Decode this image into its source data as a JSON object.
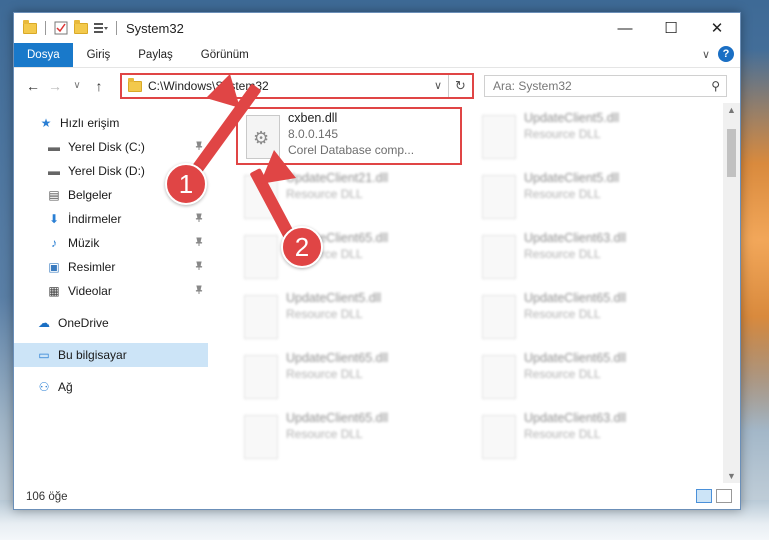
{
  "window": {
    "title": "System32",
    "controls": {
      "minimize": "—",
      "maximize": "☐",
      "close": "✕"
    }
  },
  "ribbon": {
    "tabs": [
      "Dosya",
      "Giriş",
      "Paylaş",
      "Görünüm"
    ],
    "collapse": "∨",
    "help": "?"
  },
  "nav": {
    "back": "←",
    "forward": "→",
    "recent": "∨",
    "up": "↑",
    "address": "C:\\Windows\\System32",
    "address_dropdown": "∨",
    "refresh": "↻",
    "search_placeholder": "Ara: System32",
    "search_icon": "⚲"
  },
  "sidebar": {
    "items": [
      {
        "label": "Hızlı erişim",
        "icon": "★",
        "pinned": false
      },
      {
        "label": "Yerel Disk (C:)",
        "icon": "▬",
        "pinned": true
      },
      {
        "label": "Yerel Disk (D:)",
        "icon": "▬",
        "pinned": true
      },
      {
        "label": "Belgeler",
        "icon": "▤",
        "pinned": true
      },
      {
        "label": "İndirmeler",
        "icon": "⬇",
        "pinned": true
      },
      {
        "label": "Müzik",
        "icon": "♪",
        "pinned": true
      },
      {
        "label": "Resimler",
        "icon": "▣",
        "pinned": true
      },
      {
        "label": "Videolar",
        "icon": "▦",
        "pinned": true
      },
      {
        "label": "OneDrive",
        "icon": "☁",
        "pinned": false
      },
      {
        "label": "Bu bilgisayar",
        "icon": "▭",
        "pinned": false
      },
      {
        "label": "Ağ",
        "icon": "⚇",
        "pinned": false
      }
    ],
    "pin_glyph": "📌"
  },
  "files": {
    "highlighted": {
      "name": "cxben.dll",
      "version": "8.0.0.145",
      "description": "Corel Database comp..."
    },
    "blurred": [
      {
        "name": "UpdateClient5.dll",
        "type": "Resource DLL"
      },
      {
        "name": "UpdateClient21.dll",
        "type": "Resource DLL"
      },
      {
        "name": "UpdateClient5.dll",
        "type": "Resource DLL"
      },
      {
        "name": "UpdateClient65.dll",
        "type": "Resource DLL"
      },
      {
        "name": "UpdateClient63.dll",
        "type": "Resource DLL"
      },
      {
        "name": "UpdateClient5.dll",
        "type": "Resource DLL"
      },
      {
        "name": "UpdateClient65.dll",
        "type": "Resource DLL"
      },
      {
        "name": "UpdateClient65.dll",
        "type": "Resource DLL"
      },
      {
        "name": "UpdateClient65.dll",
        "type": "Resource DLL"
      },
      {
        "name": "UpdateClient65.dll",
        "type": "Resource DLL"
      },
      {
        "name": "UpdateClient63.dll",
        "type": "Resource DLL"
      }
    ]
  },
  "status": {
    "count": "106 öğe"
  },
  "callouts": {
    "one": "1",
    "two": "2"
  },
  "colors": {
    "accent": "#1979ca",
    "highlight": "#e04545"
  }
}
